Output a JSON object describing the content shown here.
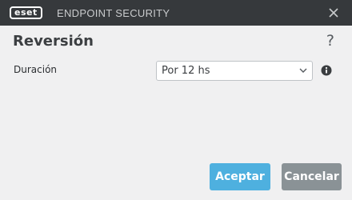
{
  "titlebar": {
    "logo_text": "eset",
    "product_name": "ENDPOINT SECURITY",
    "close_icon": "close-icon"
  },
  "dialog": {
    "title": "Reversión",
    "help_label": "?"
  },
  "form": {
    "duration_label": "Duración",
    "duration_selected": "Por 12 hs",
    "info_icon": "info-icon"
  },
  "buttons": {
    "accept_label": "Aceptar",
    "cancel_label": "Cancelar"
  },
  "colors": {
    "titlebar_bg": "#36393c",
    "body_bg": "#f0f0f1",
    "accept_bg": "#4eb0df",
    "cancel_bg": "#8a9296"
  }
}
